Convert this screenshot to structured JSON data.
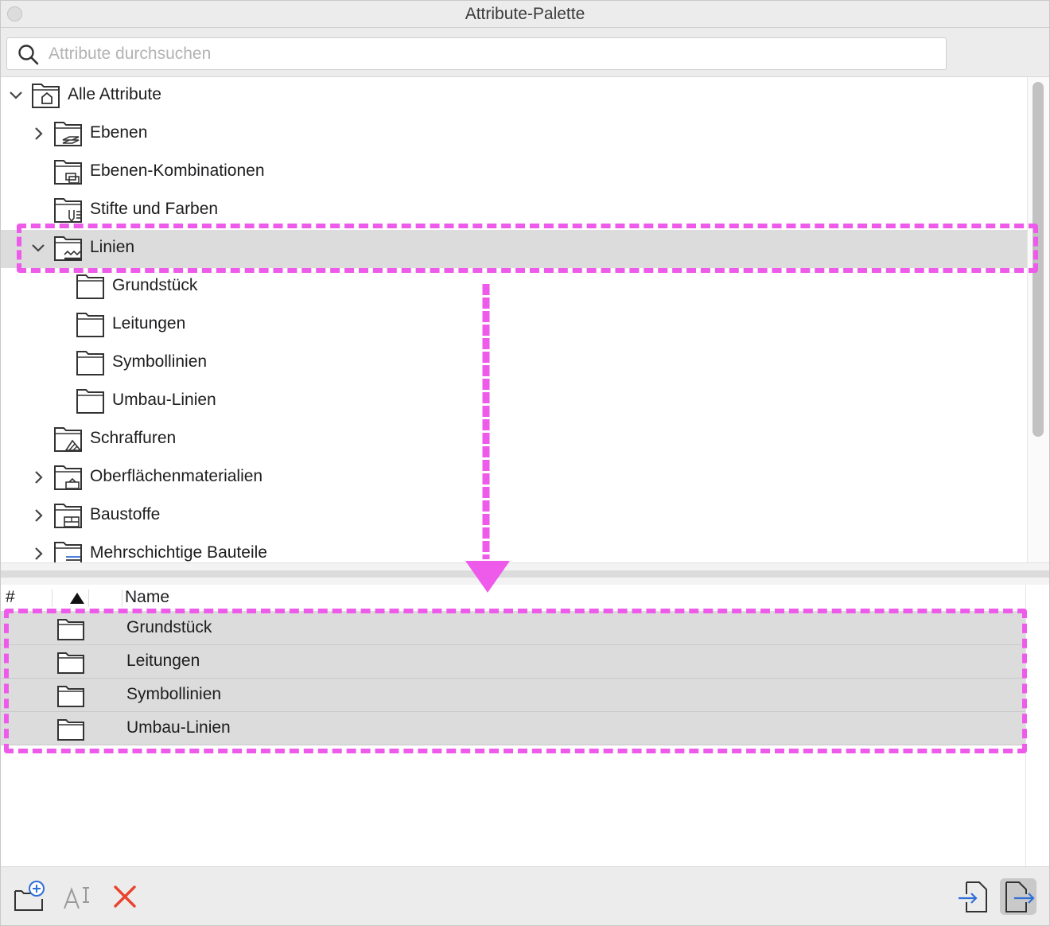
{
  "window": {
    "title": "Attribute-Palette"
  },
  "search": {
    "placeholder": "Attribute durchsuchen",
    "value": ""
  },
  "view_buttons": [
    {
      "name": "tree-view",
      "active": true,
      "icon": "folder-tree-icon"
    },
    {
      "name": "list-view",
      "active": false,
      "icon": "list-view-icon"
    }
  ],
  "tree": {
    "items": [
      {
        "label": "Alle Attribute",
        "level": 0,
        "expanded": true,
        "has_children": true,
        "icon": "all-attributes-folder-icon",
        "selected": false
      },
      {
        "label": "Ebenen",
        "level": 1,
        "expanded": false,
        "has_children": true,
        "icon": "layers-folder-icon",
        "selected": false
      },
      {
        "label": "Ebenen-Kombinationen",
        "level": 1,
        "expanded": false,
        "has_children": false,
        "icon": "layer-combinations-folder-icon",
        "selected": false
      },
      {
        "label": "Stifte und Farben",
        "level": 1,
        "expanded": false,
        "has_children": false,
        "icon": "pens-colors-folder-icon",
        "selected": false
      },
      {
        "label": "Linien",
        "level": 1,
        "expanded": true,
        "has_children": true,
        "icon": "lines-folder-icon",
        "selected": true
      },
      {
        "label": "Grundstück",
        "level": 2,
        "expanded": false,
        "has_children": false,
        "icon": "folder-icon",
        "selected": false
      },
      {
        "label": "Leitungen",
        "level": 2,
        "expanded": false,
        "has_children": false,
        "icon": "folder-icon",
        "selected": false
      },
      {
        "label": "Symbollinien",
        "level": 2,
        "expanded": false,
        "has_children": false,
        "icon": "folder-icon",
        "selected": false
      },
      {
        "label": "Umbau-Linien",
        "level": 2,
        "expanded": false,
        "has_children": false,
        "icon": "folder-icon",
        "selected": false
      },
      {
        "label": "Schraffuren",
        "level": 1,
        "expanded": false,
        "has_children": false,
        "icon": "fills-folder-icon",
        "selected": false
      },
      {
        "label": "Oberflächenmaterialien",
        "level": 1,
        "expanded": false,
        "has_children": true,
        "icon": "surfaces-folder-icon",
        "selected": false
      },
      {
        "label": "Baustoffe",
        "level": 1,
        "expanded": false,
        "has_children": true,
        "icon": "building-materials-folder-icon",
        "selected": false
      },
      {
        "label": "Mehrschichtige Bauteile",
        "level": 1,
        "expanded": false,
        "has_children": true,
        "icon": "composites-folder-icon",
        "selected": false
      }
    ]
  },
  "list": {
    "columns": [
      "#",
      "Name"
    ],
    "sort": "ascending",
    "rows": [
      {
        "name": "Grundstück",
        "icon": "folder-icon"
      },
      {
        "name": "Leitungen",
        "icon": "folder-icon"
      },
      {
        "name": "Symbollinien",
        "icon": "folder-icon"
      },
      {
        "name": "Umbau-Linien",
        "icon": "folder-icon"
      }
    ]
  },
  "toolbar": {
    "left": [
      {
        "name": "new-folder-button",
        "icon": "new-folder-icon",
        "enabled": true
      },
      {
        "name": "rename-button",
        "icon": "rename-icon",
        "enabled": false
      },
      {
        "name": "delete-button",
        "icon": "delete-icon",
        "enabled": true,
        "color": "#e8442f"
      }
    ],
    "right": [
      {
        "name": "import-button",
        "icon": "import-icon",
        "active": false
      },
      {
        "name": "export-button",
        "icon": "export-icon",
        "active": true
      }
    ]
  },
  "colors": {
    "selection": "#dcdcdc",
    "annotation": "#ee5bea",
    "accent_blue": "#2f6fd6",
    "delete_red": "#e8442f"
  }
}
